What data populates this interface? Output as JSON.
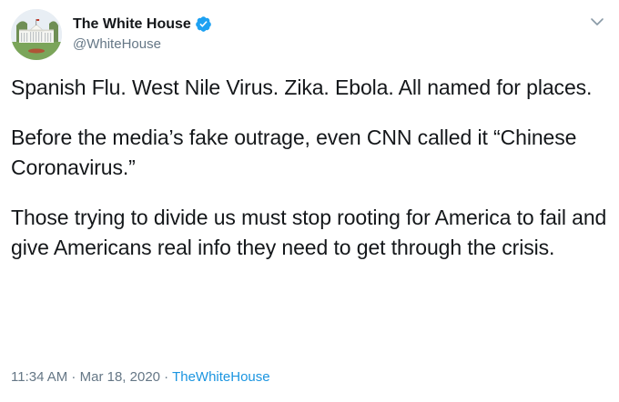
{
  "account": {
    "name": "The White House",
    "handle": "@WhiteHouse",
    "verified": true
  },
  "tweet": {
    "paragraphs": [
      "Spanish Flu. West Nile Virus. Zika. Ebola. All named for places.",
      "Before the media’s fake outrage, even CNN called it “Chinese Coronavirus.”",
      "Those trying to divide us must stop rooting for America to fail and give Americans real info they need to get through the crisis."
    ],
    "time": "11:34 AM",
    "separator1": " · ",
    "date": "Mar 18, 2020",
    "separator2": " · ",
    "source": "TheWhiteHouse"
  },
  "icons": {
    "verified": "verified-badge-icon",
    "menu": "chevron-down-icon"
  },
  "colors": {
    "text": "#14171a",
    "secondary": "#657786",
    "accent": "#1da1f2",
    "link": "#1b95e0"
  }
}
